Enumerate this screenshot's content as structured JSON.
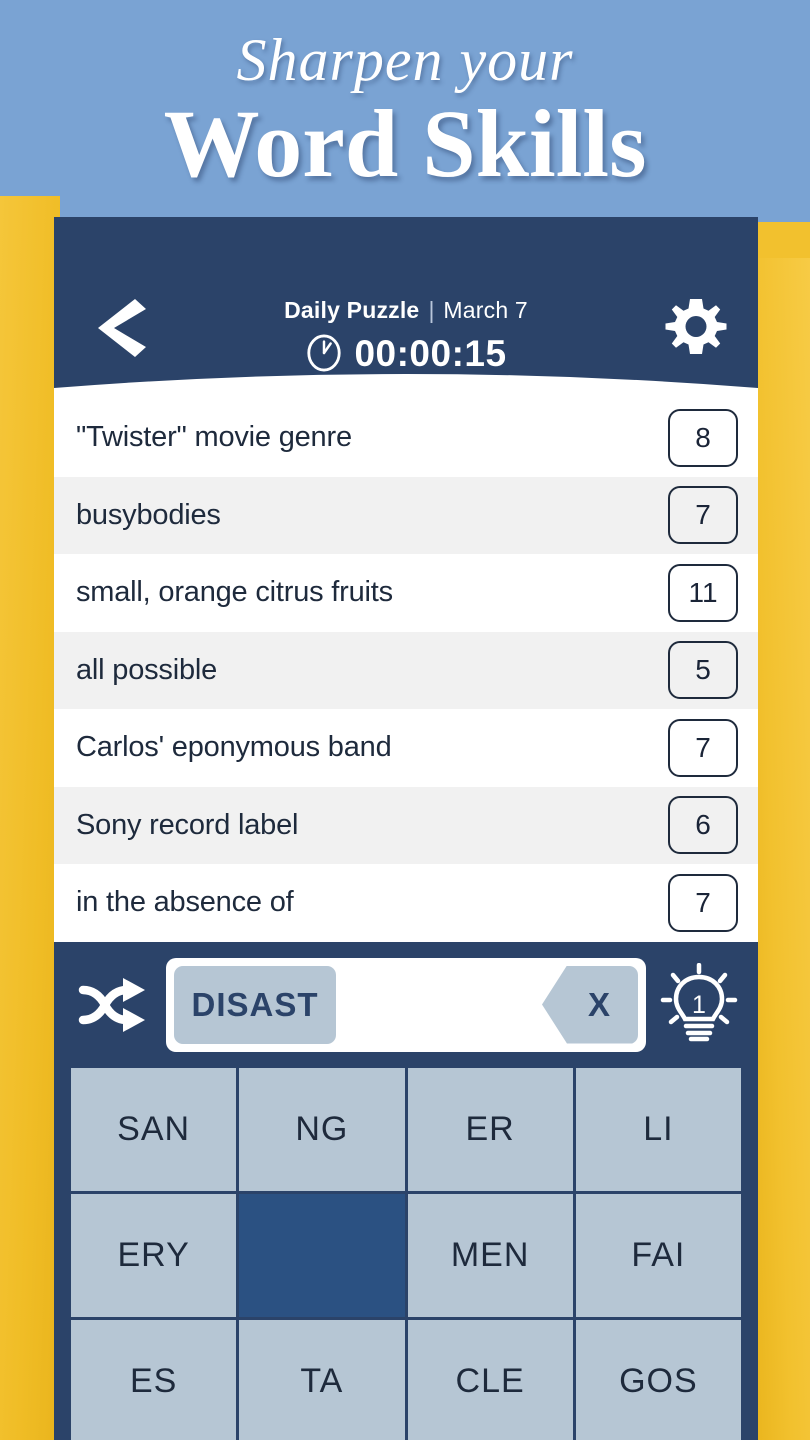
{
  "promo": {
    "line1": "Sharpen your",
    "line2": "Word Skills"
  },
  "colors": {
    "banner_blue": "#7aa3d3",
    "app_navy": "#2b4369",
    "yellow": "#f2c12e",
    "tile_blue": "#b6c6d4",
    "tile_used": "#2b5182",
    "text_dark": "#1e2a3c"
  },
  "header": {
    "back_icon": "chevron-left-icon",
    "title": "Daily Puzzle",
    "separator": "|",
    "date": "March 7",
    "clock_icon": "clock-icon",
    "timer": "00:00:15",
    "settings_icon": "gear-icon"
  },
  "clues": [
    {
      "text": "\"Twister\" movie genre",
      "length": "8"
    },
    {
      "text": "busybodies",
      "length": "7"
    },
    {
      "text": "small, orange citrus fruits",
      "length": "11"
    },
    {
      "text": "all possible",
      "length": "5"
    },
    {
      "text": "Carlos' eponymous band",
      "length": "7"
    },
    {
      "text": "Sony record label",
      "length": "6"
    },
    {
      "text": "in the absence of",
      "length": "7"
    }
  ],
  "answer_bar": {
    "shuffle_icon": "shuffle-icon",
    "current_answer": "DISAST",
    "delete_label": "X",
    "hint_icon": "lightbulb-icon",
    "hint_count": "1"
  },
  "tiles": [
    {
      "label": "SAN",
      "used": false
    },
    {
      "label": "NG",
      "used": false
    },
    {
      "label": "ER",
      "used": false
    },
    {
      "label": "LI",
      "used": false
    },
    {
      "label": "ERY",
      "used": false
    },
    {
      "label": "",
      "used": true
    },
    {
      "label": "MEN",
      "used": false
    },
    {
      "label": "FAI",
      "used": false
    },
    {
      "label": "ES",
      "used": false
    },
    {
      "label": "TA",
      "used": false
    },
    {
      "label": "CLE",
      "used": false
    },
    {
      "label": "GOS",
      "used": false
    }
  ]
}
